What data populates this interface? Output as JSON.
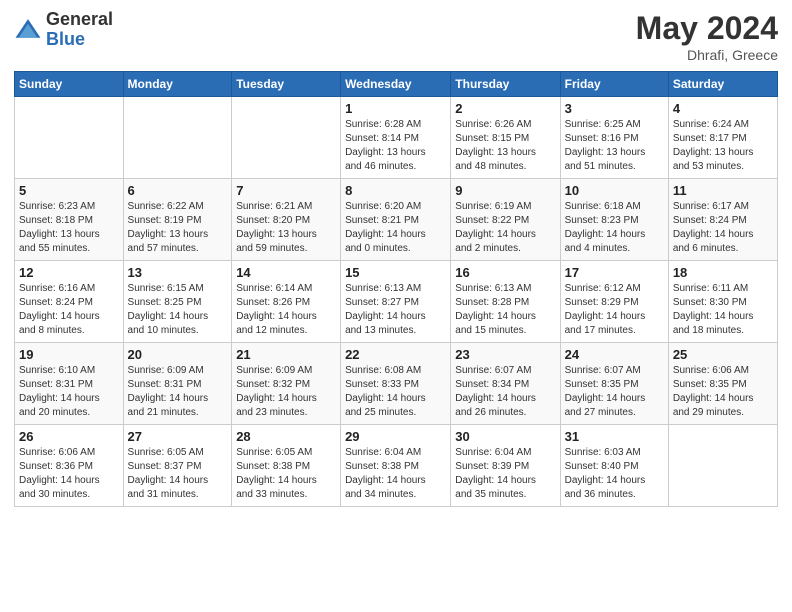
{
  "header": {
    "logo_general": "General",
    "logo_blue": "Blue",
    "title": "May 2024",
    "location": "Dhrafi, Greece"
  },
  "days_of_week": [
    "Sunday",
    "Monday",
    "Tuesday",
    "Wednesday",
    "Thursday",
    "Friday",
    "Saturday"
  ],
  "weeks": [
    [
      {
        "day": "",
        "info": ""
      },
      {
        "day": "",
        "info": ""
      },
      {
        "day": "",
        "info": ""
      },
      {
        "day": "1",
        "info": "Sunrise: 6:28 AM\nSunset: 8:14 PM\nDaylight: 13 hours\nand 46 minutes."
      },
      {
        "day": "2",
        "info": "Sunrise: 6:26 AM\nSunset: 8:15 PM\nDaylight: 13 hours\nand 48 minutes."
      },
      {
        "day": "3",
        "info": "Sunrise: 6:25 AM\nSunset: 8:16 PM\nDaylight: 13 hours\nand 51 minutes."
      },
      {
        "day": "4",
        "info": "Sunrise: 6:24 AM\nSunset: 8:17 PM\nDaylight: 13 hours\nand 53 minutes."
      }
    ],
    [
      {
        "day": "5",
        "info": "Sunrise: 6:23 AM\nSunset: 8:18 PM\nDaylight: 13 hours\nand 55 minutes."
      },
      {
        "day": "6",
        "info": "Sunrise: 6:22 AM\nSunset: 8:19 PM\nDaylight: 13 hours\nand 57 minutes."
      },
      {
        "day": "7",
        "info": "Sunrise: 6:21 AM\nSunset: 8:20 PM\nDaylight: 13 hours\nand 59 minutes."
      },
      {
        "day": "8",
        "info": "Sunrise: 6:20 AM\nSunset: 8:21 PM\nDaylight: 14 hours\nand 0 minutes."
      },
      {
        "day": "9",
        "info": "Sunrise: 6:19 AM\nSunset: 8:22 PM\nDaylight: 14 hours\nand 2 minutes."
      },
      {
        "day": "10",
        "info": "Sunrise: 6:18 AM\nSunset: 8:23 PM\nDaylight: 14 hours\nand 4 minutes."
      },
      {
        "day": "11",
        "info": "Sunrise: 6:17 AM\nSunset: 8:24 PM\nDaylight: 14 hours\nand 6 minutes."
      }
    ],
    [
      {
        "day": "12",
        "info": "Sunrise: 6:16 AM\nSunset: 8:24 PM\nDaylight: 14 hours\nand 8 minutes."
      },
      {
        "day": "13",
        "info": "Sunrise: 6:15 AM\nSunset: 8:25 PM\nDaylight: 14 hours\nand 10 minutes."
      },
      {
        "day": "14",
        "info": "Sunrise: 6:14 AM\nSunset: 8:26 PM\nDaylight: 14 hours\nand 12 minutes."
      },
      {
        "day": "15",
        "info": "Sunrise: 6:13 AM\nSunset: 8:27 PM\nDaylight: 14 hours\nand 13 minutes."
      },
      {
        "day": "16",
        "info": "Sunrise: 6:13 AM\nSunset: 8:28 PM\nDaylight: 14 hours\nand 15 minutes."
      },
      {
        "day": "17",
        "info": "Sunrise: 6:12 AM\nSunset: 8:29 PM\nDaylight: 14 hours\nand 17 minutes."
      },
      {
        "day": "18",
        "info": "Sunrise: 6:11 AM\nSunset: 8:30 PM\nDaylight: 14 hours\nand 18 minutes."
      }
    ],
    [
      {
        "day": "19",
        "info": "Sunrise: 6:10 AM\nSunset: 8:31 PM\nDaylight: 14 hours\nand 20 minutes."
      },
      {
        "day": "20",
        "info": "Sunrise: 6:09 AM\nSunset: 8:31 PM\nDaylight: 14 hours\nand 21 minutes."
      },
      {
        "day": "21",
        "info": "Sunrise: 6:09 AM\nSunset: 8:32 PM\nDaylight: 14 hours\nand 23 minutes."
      },
      {
        "day": "22",
        "info": "Sunrise: 6:08 AM\nSunset: 8:33 PM\nDaylight: 14 hours\nand 25 minutes."
      },
      {
        "day": "23",
        "info": "Sunrise: 6:07 AM\nSunset: 8:34 PM\nDaylight: 14 hours\nand 26 minutes."
      },
      {
        "day": "24",
        "info": "Sunrise: 6:07 AM\nSunset: 8:35 PM\nDaylight: 14 hours\nand 27 minutes."
      },
      {
        "day": "25",
        "info": "Sunrise: 6:06 AM\nSunset: 8:35 PM\nDaylight: 14 hours\nand 29 minutes."
      }
    ],
    [
      {
        "day": "26",
        "info": "Sunrise: 6:06 AM\nSunset: 8:36 PM\nDaylight: 14 hours\nand 30 minutes."
      },
      {
        "day": "27",
        "info": "Sunrise: 6:05 AM\nSunset: 8:37 PM\nDaylight: 14 hours\nand 31 minutes."
      },
      {
        "day": "28",
        "info": "Sunrise: 6:05 AM\nSunset: 8:38 PM\nDaylight: 14 hours\nand 33 minutes."
      },
      {
        "day": "29",
        "info": "Sunrise: 6:04 AM\nSunset: 8:38 PM\nDaylight: 14 hours\nand 34 minutes."
      },
      {
        "day": "30",
        "info": "Sunrise: 6:04 AM\nSunset: 8:39 PM\nDaylight: 14 hours\nand 35 minutes."
      },
      {
        "day": "31",
        "info": "Sunrise: 6:03 AM\nSunset: 8:40 PM\nDaylight: 14 hours\nand 36 minutes."
      },
      {
        "day": "",
        "info": ""
      }
    ]
  ]
}
